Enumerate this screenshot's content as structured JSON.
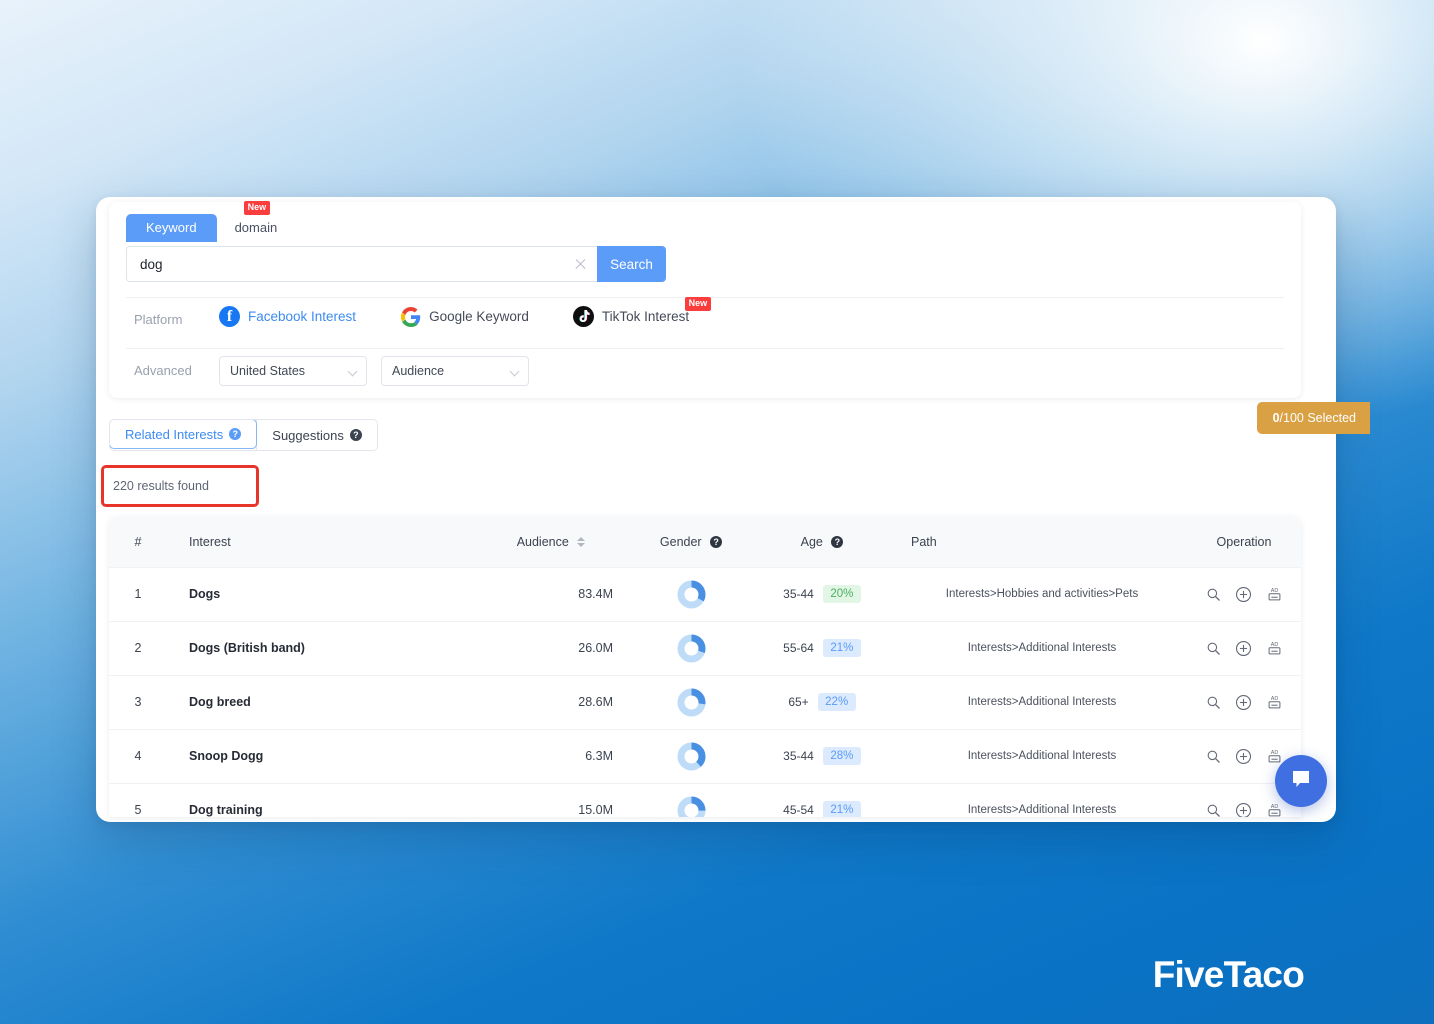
{
  "search_panel": {
    "tabs": [
      {
        "label": "Keyword",
        "active": true,
        "badge": ""
      },
      {
        "label": "domain",
        "active": false,
        "badge": "New"
      }
    ],
    "search": {
      "value": "dog",
      "placeholder": "",
      "button_label": "Search",
      "clear_icon": "close-icon"
    },
    "platform": {
      "label": "Platform",
      "options": [
        {
          "label": "Facebook Interest",
          "icon": "facebook-icon",
          "active": true,
          "badge": ""
        },
        {
          "label": "Google Keyword",
          "icon": "google-icon",
          "active": false,
          "badge": ""
        },
        {
          "label": "TikTok Interest",
          "icon": "tiktok-icon",
          "active": false,
          "badge": "New"
        }
      ]
    },
    "advanced": {
      "label": "Advanced",
      "selects": [
        {
          "value": "United States",
          "icon": "chevron-down-icon"
        },
        {
          "value": "Audience",
          "icon": "chevron-down-icon"
        }
      ]
    }
  },
  "result_tabs": [
    {
      "label": "Related Interests",
      "active": true,
      "help_icon": "question-icon"
    },
    {
      "label": "Suggestions",
      "active": false,
      "help_icon": "question-icon"
    }
  ],
  "results_count": "220 results found",
  "selected_badge": {
    "count": "0",
    "suffix": "/100 Selected"
  },
  "table": {
    "columns": [
      {
        "key": "num",
        "label": "#"
      },
      {
        "key": "int",
        "label": "Interest"
      },
      {
        "key": "aud",
        "label": "Audience",
        "sortable": true,
        "sort_icon": "sort-icon"
      },
      {
        "key": "gen",
        "label": "Gender",
        "help_icon": "question-icon"
      },
      {
        "key": "age",
        "label": "Age",
        "help_icon": "question-icon"
      },
      {
        "key": "path",
        "label": "Path"
      },
      {
        "key": "op",
        "label": "Operation"
      }
    ],
    "operation_icons": [
      "search-icon",
      "plus-circle-icon",
      "ad-icon"
    ],
    "rows": [
      {
        "num": "1",
        "interest": "Dogs",
        "audience": "83.4M",
        "gender_male_pct": 33,
        "age_range": "35-44",
        "age_pct": "20%",
        "age_pct_color": "green",
        "path": "Interests>Hobbies and activities>Pets"
      },
      {
        "num": "2",
        "interest": "Dogs (British band)",
        "audience": "26.0M",
        "gender_male_pct": 30,
        "age_range": "55-64",
        "age_pct": "21%",
        "age_pct_color": "blue",
        "path": "Interests>Additional Interests"
      },
      {
        "num": "3",
        "interest": "Dog breed",
        "audience": "28.6M",
        "gender_male_pct": 27,
        "age_range": "65+",
        "age_pct": "22%",
        "age_pct_color": "blue",
        "path": "Interests>Additional Interests"
      },
      {
        "num": "4",
        "interest": "Snoop Dogg",
        "audience": "6.3M",
        "gender_male_pct": 38,
        "age_range": "35-44",
        "age_pct": "28%",
        "age_pct_color": "blue",
        "path": "Interests>Additional Interests"
      },
      {
        "num": "5",
        "interest": "Dog training",
        "audience": "15.0M",
        "gender_male_pct": 25,
        "age_range": "45-54",
        "age_pct": "21%",
        "age_pct_color": "blue",
        "path": "Interests>Additional Interests"
      }
    ]
  },
  "chat_widget": {
    "icon": "chat-bubble-icon"
  },
  "brand": "FiveTaco",
  "colors": {
    "primary": "#5b9cf8",
    "badge_new": "#fa3e3e",
    "selected_badge": "#d9a144",
    "highlight_border": "#e8352b",
    "donut_track": "#bedcf7",
    "donut_arc": "#4a90e2"
  }
}
